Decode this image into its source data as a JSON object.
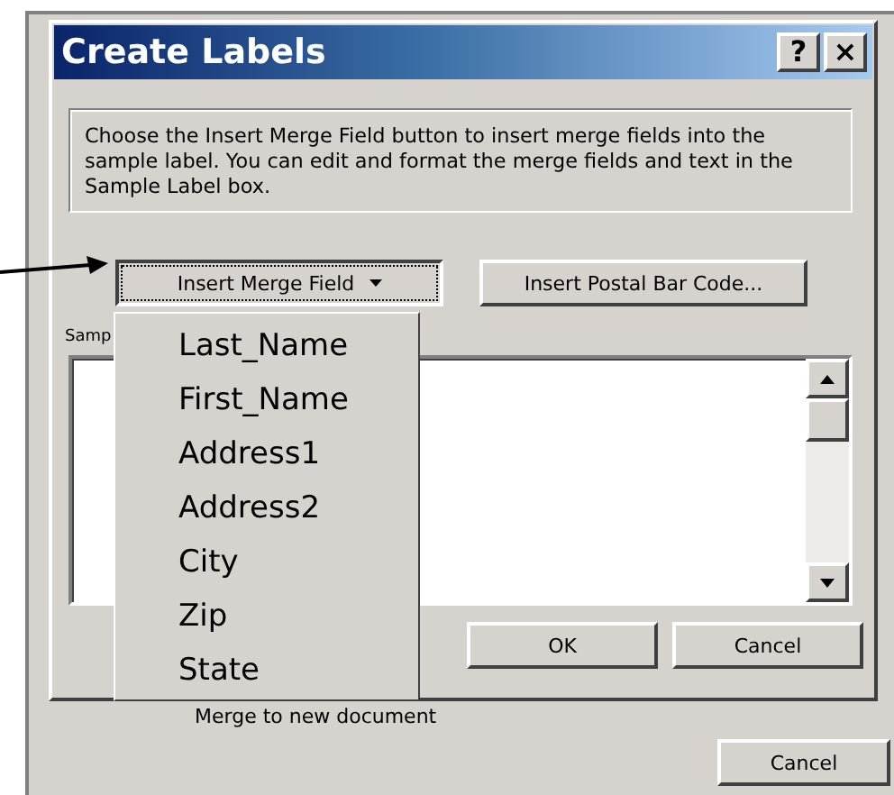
{
  "window": {
    "title": "Create Labels",
    "help_button": "?",
    "close_button": "×"
  },
  "description": "Choose the Insert Merge Field button to insert merge fields into the sample label.  You can edit and format the merge fields and text in the Sample Label box.",
  "buttons": [
    {
      "label": "Insert Merge Field",
      "dropdown": true,
      "expanded": true
    },
    {
      "label": "Insert Postal Bar Code...",
      "dropdown": false,
      "expanded": false
    }
  ],
  "sample_label": {
    "label": "Samp"
  },
  "dialog_buttons": [
    "OK",
    "Cancel"
  ],
  "merge_fields": [
    "Last_Name",
    "First_Name",
    "Address1",
    "Address2",
    "City",
    "Zip",
    "State"
  ],
  "background_window": {
    "option": "Merge to new document",
    "button": "Cancel"
  }
}
